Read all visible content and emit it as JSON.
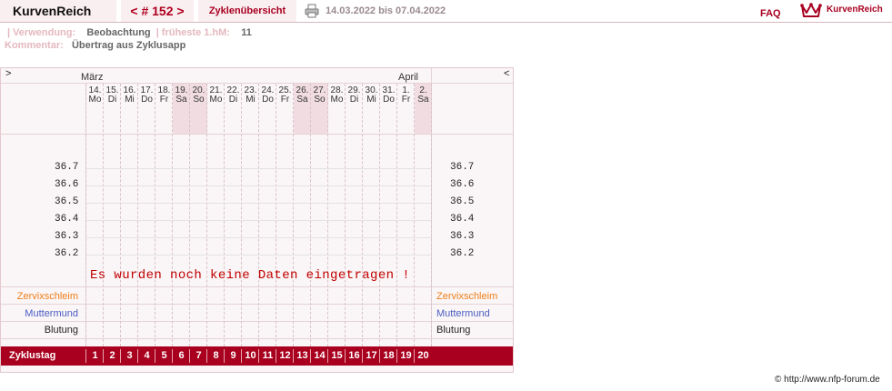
{
  "header": {
    "brand": "KurvenReich",
    "cycle_nav": "< # 152 >",
    "overview_label": "Zyklenübersicht",
    "date_range": "14.03.2022 bis 07.04.2022",
    "faq": "FAQ",
    "logo_text": "KurvenReich"
  },
  "info": {
    "usage_label": "Verwendung:",
    "usage_value": "Beobachtung",
    "earliest_label": "früheste 1.hM:",
    "earliest_value": "11",
    "comment_label": "Kommentar:",
    "comment_value": "Übertrag aus Zyklusapp"
  },
  "chart": {
    "nav_prev": ">",
    "nav_next": "<",
    "month_start": "März",
    "month_end": "April",
    "days": [
      {
        "num": "14.",
        "wd": "Mo"
      },
      {
        "num": "15.",
        "wd": "Di"
      },
      {
        "num": "16.",
        "wd": "Mi"
      },
      {
        "num": "17.",
        "wd": "Do"
      },
      {
        "num": "18.",
        "wd": "Fr"
      },
      {
        "num": "19.",
        "wd": "Sa"
      },
      {
        "num": "20.",
        "wd": "So"
      },
      {
        "num": "21.",
        "wd": "Mo"
      },
      {
        "num": "22.",
        "wd": "Di"
      },
      {
        "num": "23.",
        "wd": "Mi"
      },
      {
        "num": "24.",
        "wd": "Do"
      },
      {
        "num": "25.",
        "wd": "Fr"
      },
      {
        "num": "26.",
        "wd": "Sa"
      },
      {
        "num": "27.",
        "wd": "So"
      },
      {
        "num": "28.",
        "wd": "Mo"
      },
      {
        "num": "29.",
        "wd": "Di"
      },
      {
        "num": "30.",
        "wd": "Mi"
      },
      {
        "num": "31.",
        "wd": "Do"
      },
      {
        "num": "1.",
        "wd": "Fr"
      },
      {
        "num": "2.",
        "wd": "Sa"
      }
    ],
    "weekend_indices": [
      5,
      6,
      12,
      13,
      19
    ],
    "y_ticks": [
      "36.7",
      "36.6",
      "36.5",
      "36.4",
      "36.3",
      "36.2"
    ],
    "no_data_message": "Es wurden noch keine Daten eingetragen !",
    "rows": {
      "cervical": "Zervixschleim",
      "cervix": "Muttermund",
      "bleeding": "Blutung"
    },
    "row_colors": {
      "cervical": "#f07f1a",
      "cervix": "#4b5fc2",
      "bleeding": "#222222"
    },
    "cycle_label": "Zyklustag",
    "cycle_days": [
      "1",
      "2",
      "3",
      "4",
      "5",
      "6",
      "7",
      "8",
      "9",
      "10",
      "11",
      "12",
      "13",
      "14",
      "15",
      "16",
      "17",
      "18",
      "19",
      "20"
    ]
  },
  "footer": {
    "copyright": "© http://www.nfp-forum.de"
  }
}
